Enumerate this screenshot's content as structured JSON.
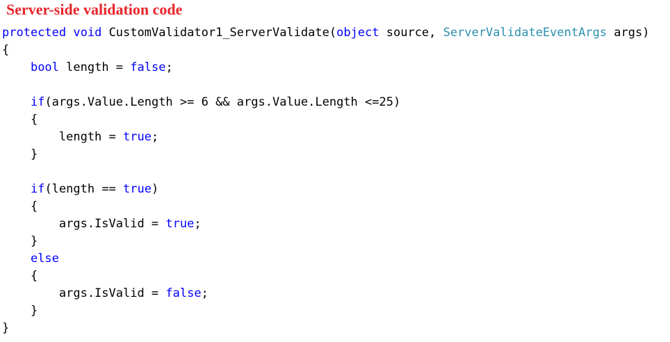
{
  "heading": "Server-side validation code",
  "colors": {
    "heading": "#e8262b",
    "keyword": "#0000ff",
    "type": "#2b91af",
    "plain": "#000000",
    "background": "#ffffff"
  },
  "code_lines": [
    [
      {
        "text": "protected",
        "kind": "kw"
      },
      {
        "text": " ",
        "kind": "plain"
      },
      {
        "text": "void",
        "kind": "kw"
      },
      {
        "text": " CustomValidator1_ServerValidate(",
        "kind": "plain"
      },
      {
        "text": "object",
        "kind": "kw"
      },
      {
        "text": " source, ",
        "kind": "plain"
      },
      {
        "text": "ServerValidateEventArgs",
        "kind": "type"
      },
      {
        "text": " args)",
        "kind": "plain"
      }
    ],
    [
      {
        "text": "{",
        "kind": "plain"
      }
    ],
    [
      {
        "text": "    ",
        "kind": "plain"
      },
      {
        "text": "bool",
        "kind": "kw"
      },
      {
        "text": " length = ",
        "kind": "plain"
      },
      {
        "text": "false",
        "kind": "kw"
      },
      {
        "text": ";",
        "kind": "plain"
      }
    ],
    [],
    [
      {
        "text": "    ",
        "kind": "plain"
      },
      {
        "text": "if",
        "kind": "kw"
      },
      {
        "text": "(args.Value.Length >= 6 && args.Value.Length <=25)",
        "kind": "plain"
      }
    ],
    [
      {
        "text": "    {",
        "kind": "plain"
      }
    ],
    [
      {
        "text": "        length = ",
        "kind": "plain"
      },
      {
        "text": "true",
        "kind": "kw"
      },
      {
        "text": ";",
        "kind": "plain"
      }
    ],
    [
      {
        "text": "    }",
        "kind": "plain"
      }
    ],
    [],
    [
      {
        "text": "    ",
        "kind": "plain"
      },
      {
        "text": "if",
        "kind": "kw"
      },
      {
        "text": "(length == ",
        "kind": "plain"
      },
      {
        "text": "true",
        "kind": "kw"
      },
      {
        "text": ")",
        "kind": "plain"
      }
    ],
    [
      {
        "text": "    {",
        "kind": "plain"
      }
    ],
    [
      {
        "text": "        args.IsValid = ",
        "kind": "plain"
      },
      {
        "text": "true",
        "kind": "kw"
      },
      {
        "text": ";",
        "kind": "plain"
      }
    ],
    [
      {
        "text": "    }",
        "kind": "plain"
      }
    ],
    [
      {
        "text": "    ",
        "kind": "plain"
      },
      {
        "text": "else",
        "kind": "kw"
      }
    ],
    [
      {
        "text": "    {",
        "kind": "plain"
      }
    ],
    [
      {
        "text": "        args.IsValid = ",
        "kind": "plain"
      },
      {
        "text": "false",
        "kind": "kw"
      },
      {
        "text": ";",
        "kind": "plain"
      }
    ],
    [
      {
        "text": "    }",
        "kind": "plain"
      }
    ],
    [
      {
        "text": "}",
        "kind": "plain"
      }
    ]
  ]
}
